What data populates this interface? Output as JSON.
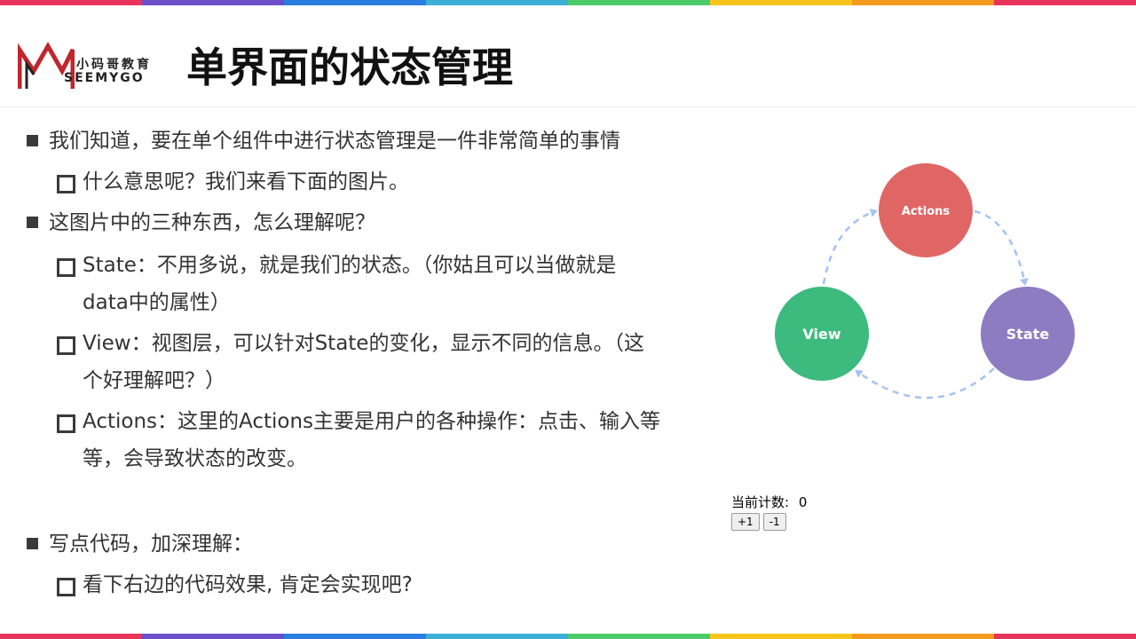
{
  "header": {
    "title": "单界面的状态管理",
    "logo_cn": "小码哥教育",
    "logo_en": "SEEMYGO",
    "logo_color": "#c0262e"
  },
  "colors": [
    "#e8345a",
    "#6a4fc8",
    "#2a7de1",
    "#3ab0d6",
    "#4ccb6a",
    "#f6c51b",
    "#f49a1c",
    "#e8345a"
  ],
  "bullets": [
    {
      "level": 1,
      "text": "我们知道，要在单个组件中进行状态管理是一件非常简单的事情"
    },
    {
      "level": 2,
      "text": "什么意思呢？我们来看下面的图片。"
    },
    {
      "level": 1,
      "text": "这图片中的三种东西，怎么理解呢？"
    },
    {
      "level": 2,
      "text": "State：不用多说，就是我们的状态。（你姑且可以当做就是",
      "cont": "data中的属性）"
    },
    {
      "level": 2,
      "text": "View：视图层，可以针对State的变化，显示不同的信息。（这",
      "cont": "个好理解吧？）"
    },
    {
      "level": 2,
      "text": "Actions：这里的Actions主要是用户的各种操作：点击、输入等",
      "cont": "等，会导致状态的改变。"
    },
    {
      "level": 1,
      "text": "写点代码，加深理解："
    },
    {
      "level": 2,
      "text": "看下右边的代码效果, 肯定会实现吧?"
    }
  ],
  "diagram": {
    "actions": {
      "label": "Actions",
      "color": "#e06666"
    },
    "state": {
      "label": "State",
      "color": "#8e7cc3"
    },
    "view": {
      "label": "View",
      "color": "#3dba7e"
    },
    "arrow_color": "#a4c2f4"
  },
  "counter": {
    "label": "当前计数:",
    "value": "0",
    "inc_label": "+1",
    "dec_label": "-1"
  }
}
